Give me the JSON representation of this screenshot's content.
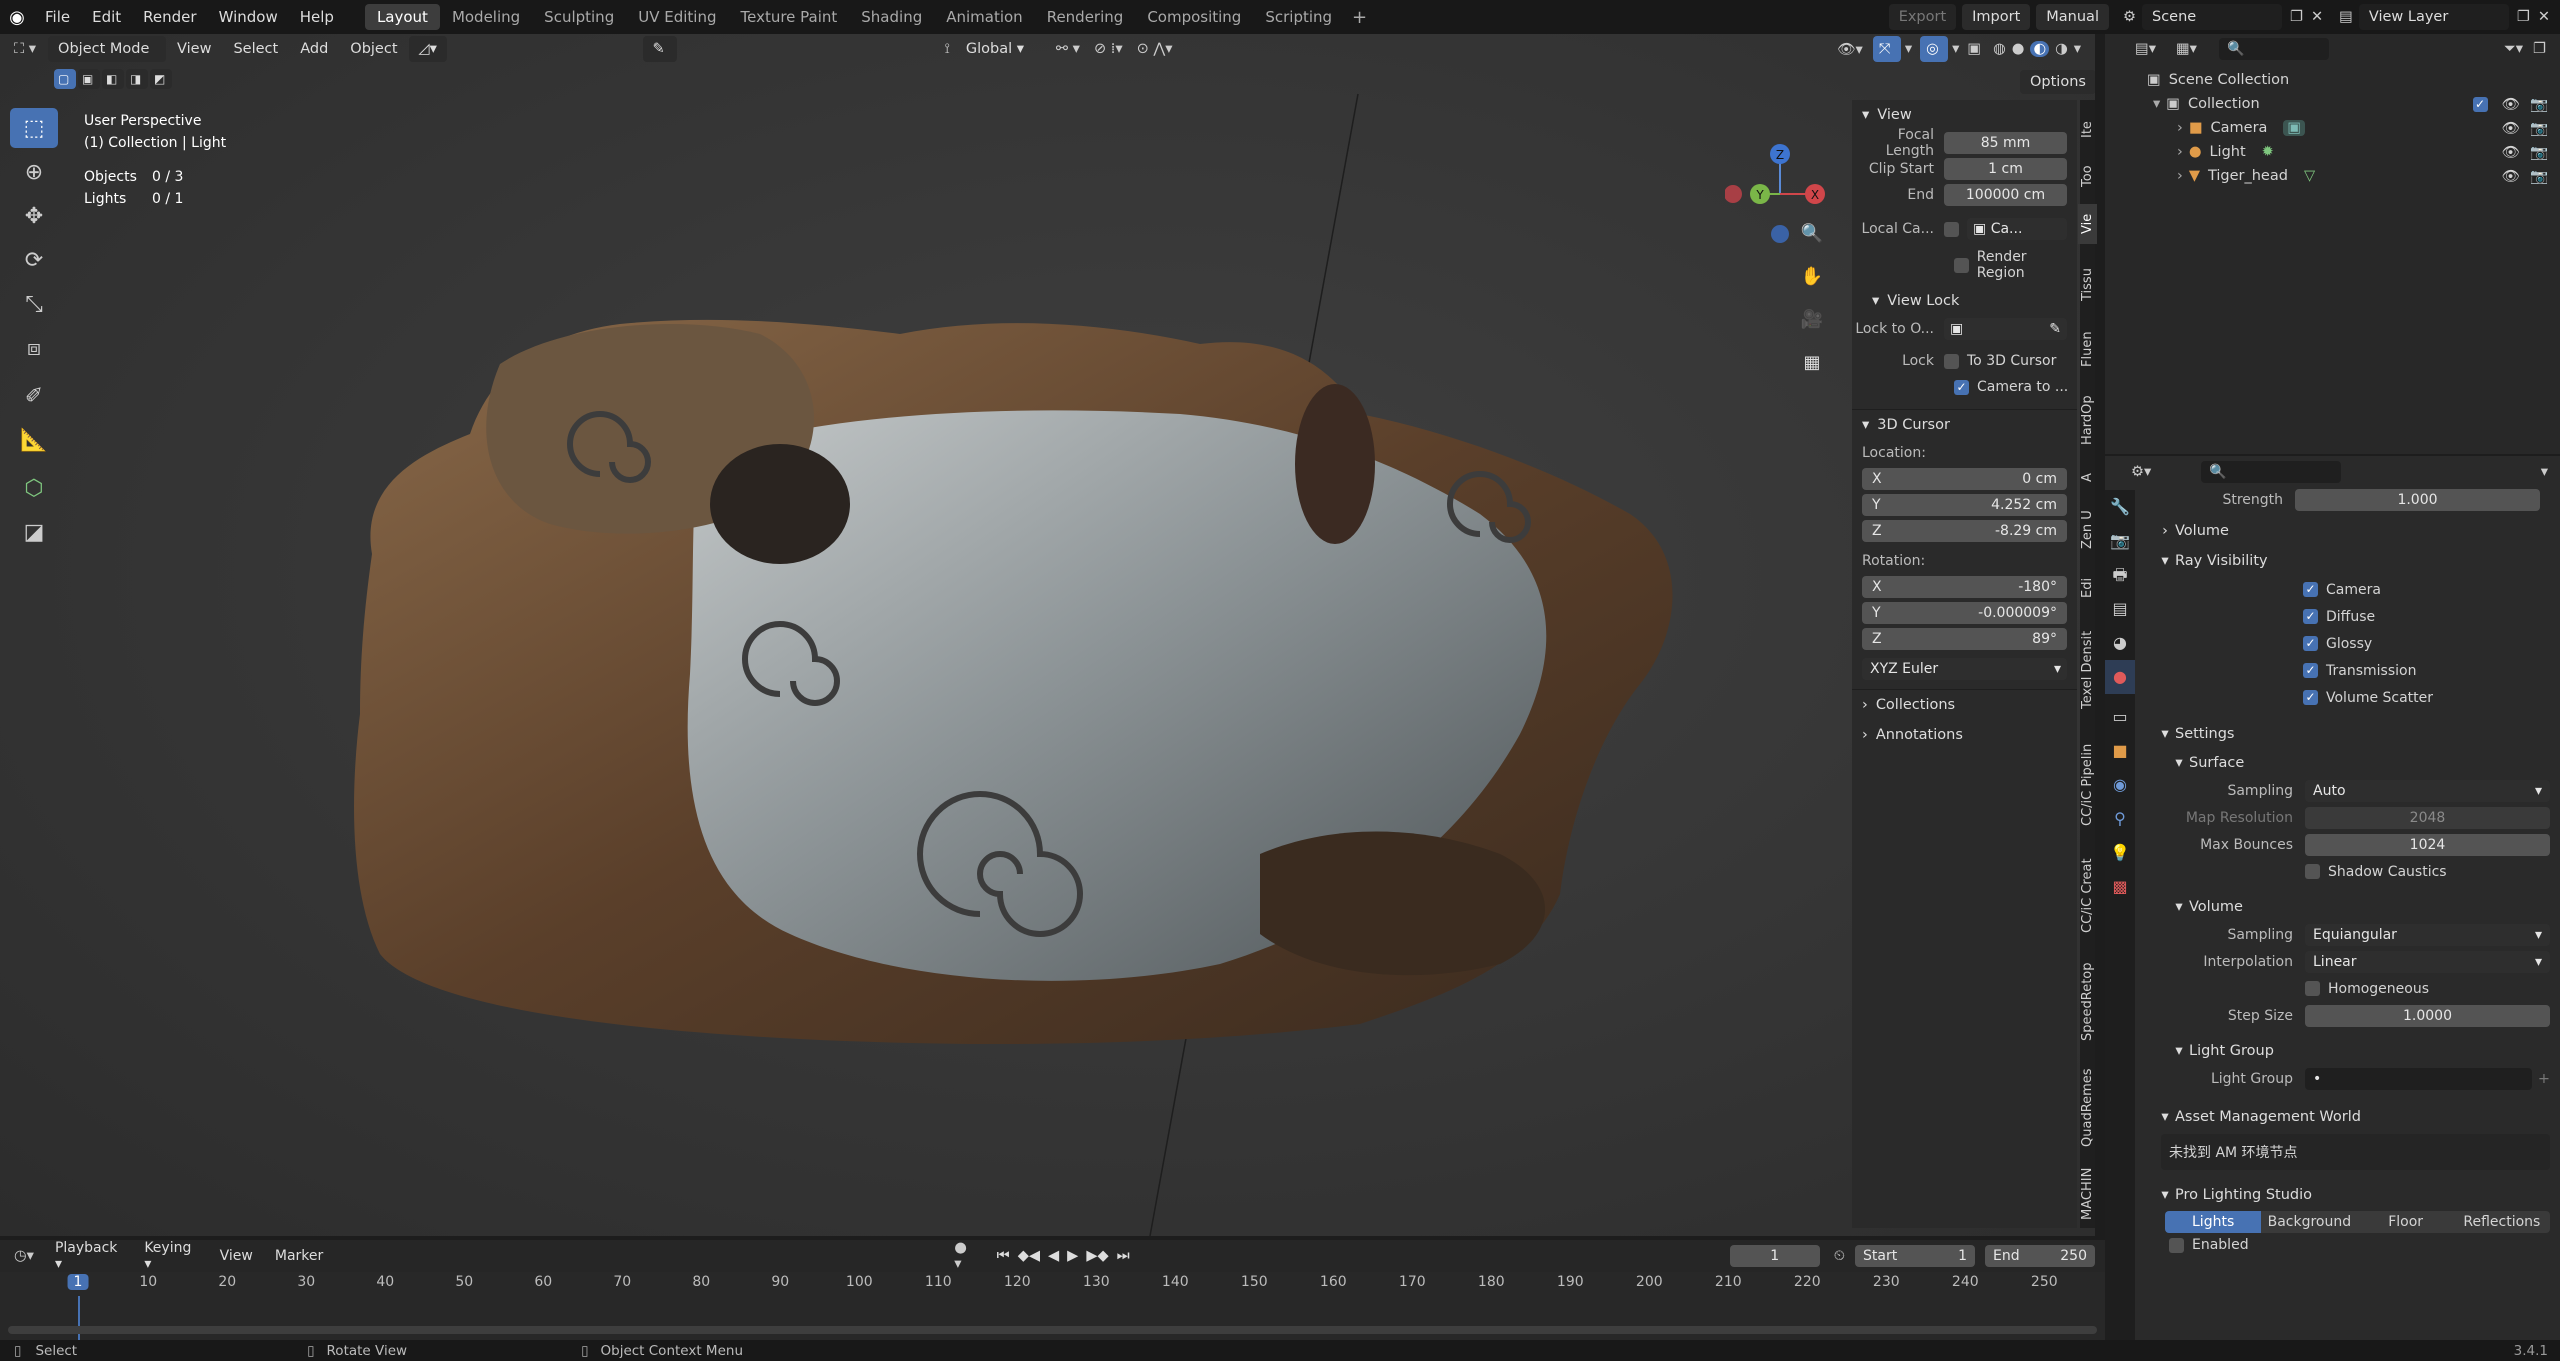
{
  "topbar": {
    "menus": [
      "File",
      "Edit",
      "Render",
      "Window",
      "Help"
    ],
    "workspaces": [
      "Layout",
      "Modeling",
      "Sculpting",
      "UV Editing",
      "Texture Paint",
      "Shading",
      "Animation",
      "Rendering",
      "Compositing",
      "Scripting"
    ],
    "active_workspace": "Layout",
    "export": "Export",
    "import": "Import",
    "manual": "Manual",
    "scene": "Scene",
    "view_layer": "View Layer"
  },
  "viewport_header": {
    "mode": "Object Mode",
    "menus": [
      "View",
      "Select",
      "Add",
      "Object"
    ],
    "transform_orientation": "Global",
    "options": "Options"
  },
  "overlay": {
    "perspective": "User Perspective",
    "collection": "(1) Collection | Light",
    "objects_label": "Objects",
    "objects_value": "0 / 3",
    "lights_label": "Lights",
    "lights_value": "0 / 1"
  },
  "gizmo": {
    "x": "X",
    "y": "Y",
    "z": "Z"
  },
  "npanel": {
    "view_title": "View",
    "focal_label": "Focal Length",
    "focal": "85 mm",
    "clip_start_label": "Clip Start",
    "clip_start": "1 cm",
    "end_label": "End",
    "end": "100000 cm",
    "local_cam_label": "Local Ca...",
    "local_cam_field": "Ca...",
    "render_region": "Render Region",
    "view_lock_title": "View Lock",
    "lock_to_label": "Lock to O...",
    "lock_label": "Lock",
    "to_cursor": "To 3D Cursor",
    "camera_to": "Camera to ...",
    "cursor_title": "3D Cursor",
    "location_label": "Location:",
    "loc_x": "0 cm",
    "loc_y": "4.252 cm",
    "loc_z": "-8.29 cm",
    "rotation_label": "Rotation:",
    "rot_x": "-180°",
    "rot_y": "-0.000009°",
    "rot_z": "89°",
    "rot_mode": "XYZ Euler",
    "collections": "Collections",
    "annotations": "Annotations",
    "axis_x": "X",
    "axis_y": "Y",
    "axis_z": "Z"
  },
  "ntabs": [
    "Ite",
    "Too",
    "Vie",
    "Tissu",
    "Fluen",
    "HardOp",
    "A",
    "Zen U",
    "Edi",
    "Texel Densit",
    "CC/iC Pipelin",
    "CC/iC Creat",
    "SpeedRetop",
    "QuadRemes",
    "MACHIN"
  ],
  "outliner": {
    "root": "Scene Collection",
    "collection": "Collection",
    "items": [
      "Camera",
      "Light",
      "Tiger_head"
    ]
  },
  "props": {
    "strength_label": "Strength",
    "strength": "1.000",
    "volume": "Volume",
    "ray_visibility": "Ray Visibility",
    "rays": [
      "Camera",
      "Diffuse",
      "Glossy",
      "Transmission",
      "Volume Scatter"
    ],
    "settings": "Settings",
    "surface": "Surface",
    "sampling_label": "Sampling",
    "surface_sampling": "Auto",
    "map_res_label": "Map Resolution",
    "map_res": "2048",
    "max_bounces_label": "Max Bounces",
    "max_bounces": "1024",
    "shadow_caustics": "Shadow Caustics",
    "volume_sub": "Volume",
    "volume_sampling": "Equiangular",
    "interpolation_label": "Interpolation",
    "interpolation": "Linear",
    "homogeneous": "Homogeneous",
    "step_size_label": "Step Size",
    "step_size": "1.0000",
    "light_group": "Light Group",
    "light_group_label": "Light Group",
    "asset_mgmt": "Asset Management World",
    "am_message": "未找到 AM 环境节点",
    "pro_lighting": "Pro Lighting Studio",
    "pls_tabs": [
      "Lights",
      "Background",
      "Floor",
      "Reflections"
    ],
    "enabled": "Enabled"
  },
  "timeline": {
    "menus": [
      "Playback",
      "Keying",
      "View",
      "Marker"
    ],
    "current_frame": "1",
    "start_label": "Start",
    "start": "1",
    "end_label": "End",
    "end": "250",
    "ticks": [
      "1",
      "10",
      "20",
      "30",
      "40",
      "50",
      "60",
      "70",
      "80",
      "90",
      "100",
      "110",
      "120",
      "130",
      "140",
      "150",
      "160",
      "170",
      "180",
      "190",
      "200",
      "210",
      "220",
      "230",
      "240",
      "250"
    ]
  },
  "status": {
    "select": "Select",
    "rotate": "Rotate View",
    "context": "Object Context Menu",
    "version": "3.4.1"
  }
}
